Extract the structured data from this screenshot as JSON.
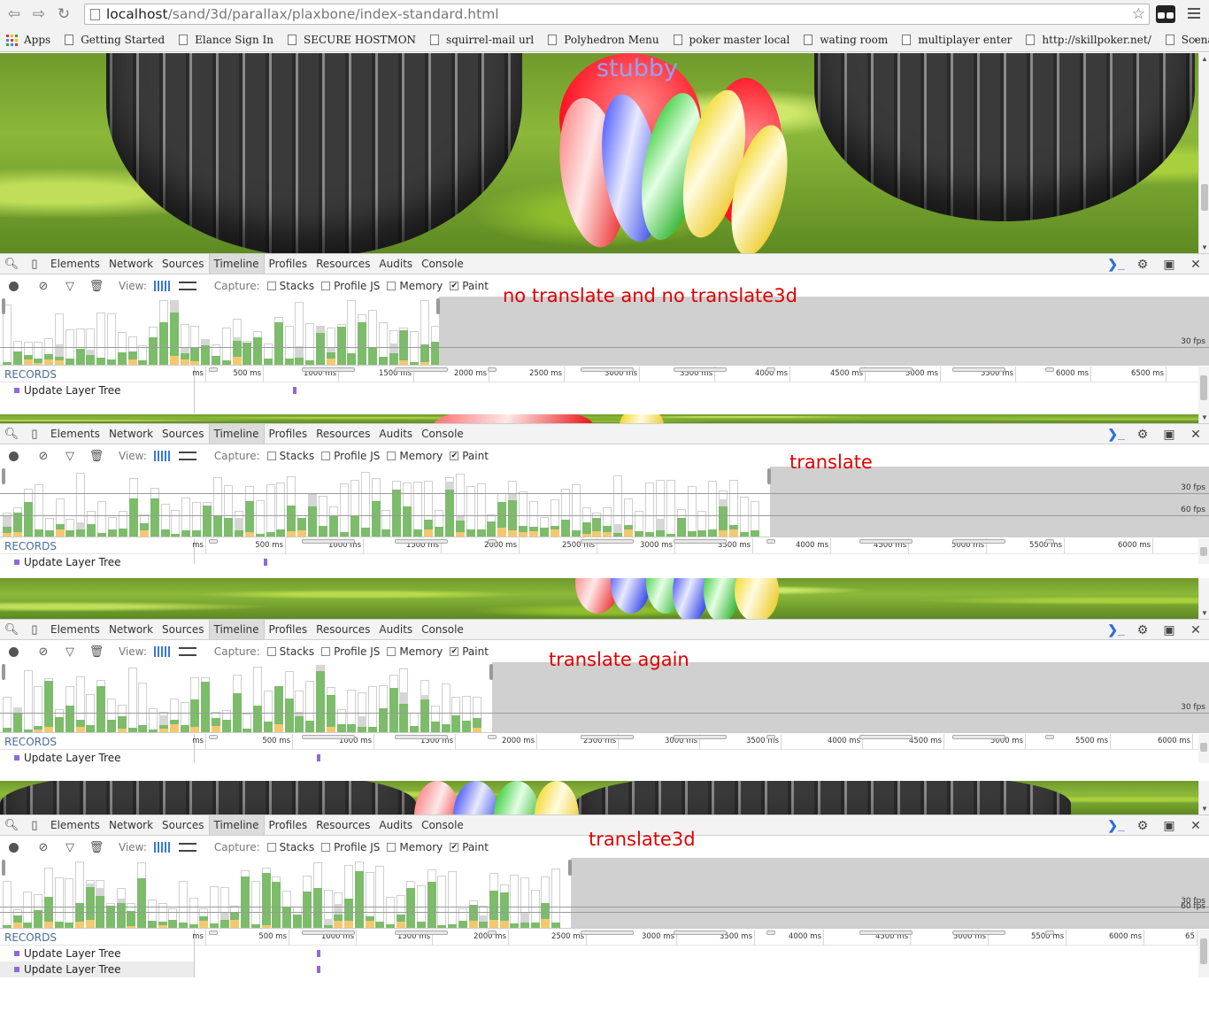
{
  "browser": {
    "url_host": "localhost",
    "url_path": "/sand/3d/parallax/plaxbone/index-standard.html",
    "bookmarks": [
      "Apps",
      "Getting Started",
      "Elance Sign In",
      "SECURE HOSTMON",
      "squirrel-mail url",
      "Polyhedron Menu",
      "poker master local",
      "wating room",
      "multiplayer enter",
      "http://skillpoker.net/",
      "Scenarion"
    ],
    "more": "»"
  },
  "page": {
    "balloon_label": "stubby"
  },
  "devtools": {
    "tabs": [
      "Elements",
      "Network",
      "Sources",
      "Timeline",
      "Profiles",
      "Resources",
      "Audits",
      "Console"
    ],
    "active_tab": "Timeline",
    "view_label": "View:",
    "capture_label": "Capture:",
    "capture_options": [
      {
        "label": "Stacks",
        "checked": false
      },
      {
        "label": "Profile JS",
        "checked": false
      },
      {
        "label": "Memory",
        "checked": false
      },
      {
        "label": "Paint",
        "checked": true
      }
    ],
    "records_label": "RECORDS",
    "colors": {
      "scripting": "#f3c870",
      "rendering": "#8f6ad8",
      "painting": "#7cbc6b",
      "other": "#d6d6d6"
    }
  },
  "panels": [
    {
      "annotation": "no translate and no translate3d",
      "fps_lines": [
        {
          "label": "30 fps"
        }
      ],
      "ticks": [
        "ms",
        "500 ms",
        "1000 ms",
        "1500 ms",
        "2000 ms",
        "2500 ms",
        "3000 ms",
        "3500 ms",
        "4000 ms",
        "4500 ms",
        "5000 ms",
        "5500 ms",
        "6000 ms",
        "6500 ms"
      ],
      "records": [
        "Update Layer Tree"
      ]
    },
    {
      "annotation": "translate",
      "fps_lines": [
        {
          "label": "30 fps"
        },
        {
          "label": "60 fps"
        }
      ],
      "ticks": [
        "ms",
        "500 ms",
        "1000 ms",
        "1500 ms",
        "2000 ms",
        "2500 ms",
        "3000 ms",
        "3500 ms",
        "4000 ms",
        "4500 ms",
        "5000 ms",
        "5500 ms",
        "6000 ms"
      ],
      "records": [
        "Update Layer Tree"
      ]
    },
    {
      "annotation": "translate again",
      "fps_lines": [
        {
          "label": "30 fps"
        }
      ],
      "ticks": [
        "ms",
        "500 ms",
        "1000 ms",
        "1500 ms",
        "2000 ms",
        "2500 ms",
        "3000 ms",
        "3500 ms",
        "4000 ms",
        "4500 ms",
        "5000 ms",
        "5500 ms",
        "6000 ms"
      ],
      "records": [
        "Update Layer Tree"
      ]
    },
    {
      "annotation": "translate3d",
      "fps_lines": [
        {
          "label": "30 fps"
        },
        {
          "label": "60 fps"
        }
      ],
      "ticks": [
        "ms",
        "500 ms",
        "1000 ms",
        "1500 ms",
        "2000 ms",
        "2500 ms",
        "3000 ms",
        "3500 ms",
        "4000 ms",
        "4500 ms",
        "5000 ms",
        "5500 ms",
        "6000 ms",
        "65"
      ],
      "records": [
        "Update Layer Tree",
        "Update Layer Tree"
      ]
    }
  ]
}
